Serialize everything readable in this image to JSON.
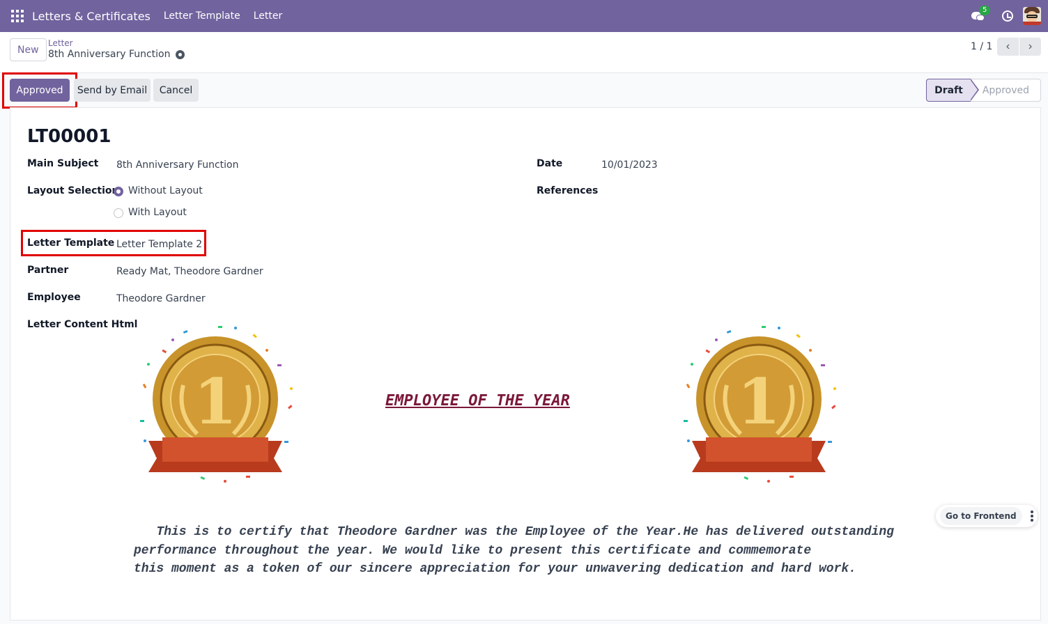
{
  "navbar": {
    "brand": "Letters & Certificates",
    "menu": [
      "Letter Template",
      "Letter"
    ],
    "messages_badge": "5"
  },
  "control_panel": {
    "new_label": "New",
    "breadcrumb_parent": "Letter",
    "breadcrumb_current": "8th Anniversary Function",
    "pager": "1 / 1"
  },
  "statusbar": {
    "buttons": [
      "Approved",
      "Send by Email",
      "Cancel"
    ],
    "stages": [
      "Draft",
      "Approved"
    ],
    "current_stage": "Draft"
  },
  "form": {
    "reference": "LT00001",
    "main_subject_label": "Main Subject",
    "main_subject": "8th Anniversary Function",
    "layout_selection_label": "Layout Selection",
    "layout_options": [
      "Without Layout",
      "With Layout"
    ],
    "layout_selected": "Without Layout",
    "letter_template_label": "Letter Template",
    "letter_template": "Letter Template 2",
    "partner_label": "Partner",
    "partner": "Ready Mat, Theodore Gardner",
    "employee_label": "Employee",
    "employee": "Theodore Gardner",
    "letter_content_label": "Letter Content Html",
    "date_label": "Date",
    "date": "10/01/2023",
    "references_label": "References"
  },
  "letter": {
    "title": "EMPLOYEE OF THE YEAR",
    "body_lines": [
      "   This is to certify that Theodore Gardner was the Employee of the Year.He has delivered outstanding",
      "performance throughout the year. We would like to present this certificate and commemorate",
      "this moment as a token of our sincere appreciation for your unwavering dedication and hard work."
    ],
    "medal_number": "1"
  },
  "widget": {
    "frontend_label": "Go to Frontend"
  },
  "colors": {
    "brand": "#71639e",
    "highlight": "#e00000",
    "letter_title": "#7b1838"
  }
}
